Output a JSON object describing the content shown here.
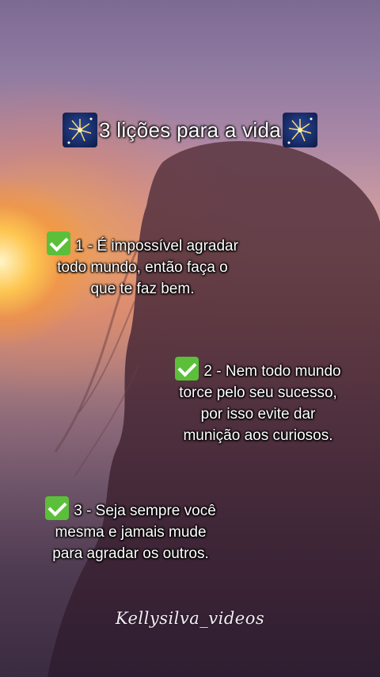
{
  "title": {
    "text": "3 lições para a vida",
    "left_icon": "fireworks-icon",
    "right_icon": "fireworks-icon"
  },
  "tips": [
    {
      "icon": "check-mark-icon",
      "lines": [
        "1 - É impossível agradar",
        "todo mundo, então faça o",
        "que te faz bem."
      ]
    },
    {
      "icon": "check-mark-icon",
      "lines": [
        "2 - Nem todo mundo",
        "torce pelo seu sucesso,",
        "por isso evite dar",
        "munição aos curiosos."
      ]
    },
    {
      "icon": "check-mark-icon",
      "lines": [
        "3 - Seja sempre você",
        "mesma e jamais mude",
        "para agradar os outros."
      ]
    }
  ],
  "watermark": "Kellysilva_videos",
  "colors": {
    "text": "#ffffff",
    "check_bg": "#5bbf3a",
    "sky_top": "#7d6a93",
    "sun": "#ffc850"
  }
}
